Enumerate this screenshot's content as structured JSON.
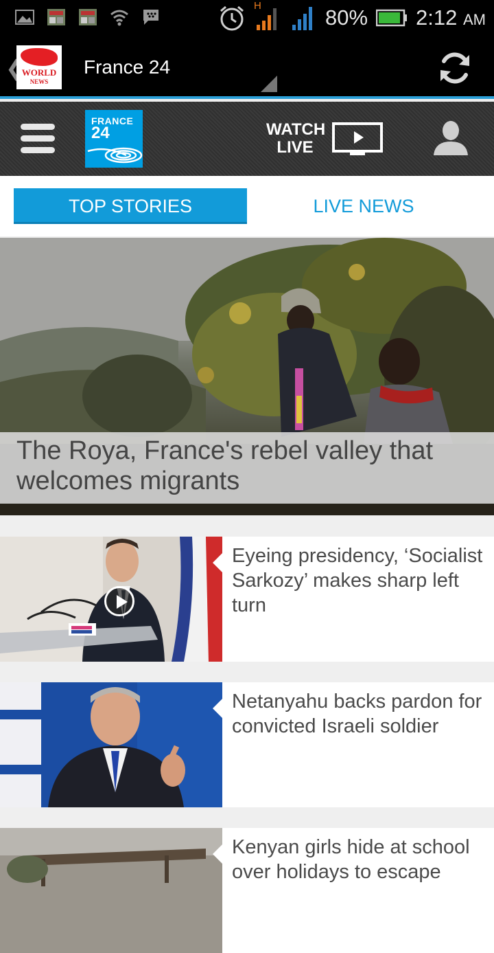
{
  "status_bar": {
    "battery": "80%",
    "time": "2:12",
    "ampm": "AM",
    "network_letter": "H"
  },
  "app_bar": {
    "logo_line1": "WORLD",
    "logo_line2": "NEWS",
    "title": "France 24"
  },
  "channel_header": {
    "logo_line1": "FRANCE",
    "logo_line2": "24",
    "watch_line1": "WATCH",
    "watch_line2": "LIVE"
  },
  "tabs": [
    {
      "label": "TOP STORIES",
      "active": true
    },
    {
      "label": "LIVE NEWS",
      "active": false
    }
  ],
  "hero": {
    "title": "The Roya, France's rebel valley that welcomes migrants"
  },
  "articles": [
    {
      "title": "Eyeing presidency, ‘Socialist Sarkozy’ makes sharp left turn",
      "video": true
    },
    {
      "title": "Netanyahu backs pardon for convicted Israeli soldier",
      "video": false
    },
    {
      "title": "Kenyan girls hide at school over holidays to escape",
      "video": false
    }
  ],
  "colors": {
    "accent": "#129bd9",
    "brand_blue": "#009fe3",
    "bar_bg": "#000000"
  }
}
